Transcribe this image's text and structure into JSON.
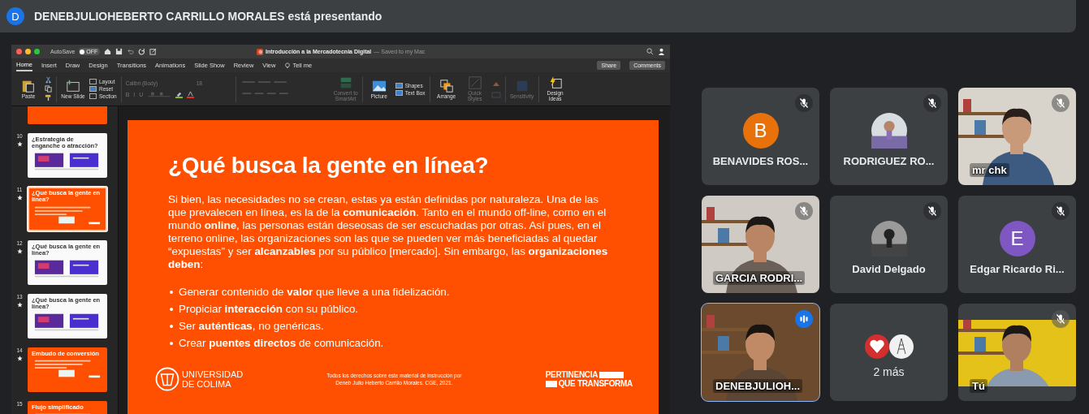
{
  "presenter_banner": {
    "avatar_letter": "D",
    "text": "DENEBJULIOHEBERTO CARRILLO MORALES está presentando"
  },
  "powerpoint": {
    "autosave_label": "AutoSave",
    "autosave_state": "OFF",
    "autosave_on": false,
    "document_title": "Introducción a la Mercadotecnia Digital",
    "save_status": "— Saved to my Mac",
    "tabs": [
      {
        "label": "Home",
        "selected": true
      },
      {
        "label": "Insert",
        "selected": false
      },
      {
        "label": "Draw",
        "selected": false
      },
      {
        "label": "Design",
        "selected": false
      },
      {
        "label": "Transitions",
        "selected": false
      },
      {
        "label": "Animations",
        "selected": false
      },
      {
        "label": "Slide Show",
        "selected": false
      },
      {
        "label": "Review",
        "selected": false
      },
      {
        "label": "View",
        "selected": false
      }
    ],
    "tell_me": "Tell me",
    "share": "Share",
    "comments": "Comments",
    "ribbon": {
      "paste": "Paste",
      "new_slide": "New Slide",
      "layout": "Layout",
      "reset": "Reset",
      "section": "Section",
      "font": "Calibri (Body)",
      "font_size": "18",
      "format_buttons": [
        "B",
        "I",
        "U"
      ],
      "convert": "Convert to SmartArt",
      "picture": "Picture",
      "shapes": "Shapes",
      "text_box": "Text Box",
      "arrange": "Arrange",
      "quick_styles": "Quick Styles",
      "sensitivity": "Sensitivity",
      "design_ideas": "Design Ideas"
    },
    "thumbnails": [
      {
        "kind": "orange",
        "selected": false
      },
      {
        "number": "10",
        "title": "¿Estrategia de enganche o atracción?",
        "kind": "light",
        "animated": true,
        "selected": false
      },
      {
        "number": "11",
        "title": "¿Qué busca la gente en línea?",
        "kind": "orange",
        "animated": true,
        "selected": true
      },
      {
        "number": "12",
        "title": "¿Qué busca la gente en línea?",
        "kind": "light",
        "animated": true,
        "selected": false
      },
      {
        "number": "13",
        "title": "¿Qué busca la gente en línea?",
        "kind": "light",
        "animated": true,
        "selected": false
      },
      {
        "number": "14",
        "title": "Embudo de conversión",
        "kind": "orange",
        "animated": true,
        "selected": false
      },
      {
        "number": "15",
        "title": "Flujo simplificado",
        "kind": "orange",
        "animated": false,
        "selected": false
      }
    ],
    "slide": {
      "title": "¿Qué busca la gente en línea?",
      "paragraph": "Si bien, las necesidades no se crean, estas ya están definidas por naturaleza. Una de las que prevalecen en línea, es la de la **comunicación**. Tanto en el mundo off-line, como en el mundo **online**, las personas están deseosas de ser escuchadas por otras. Así pues, en el terreno online, las organizaciones son las que se pueden ver más beneficiadas al quedar “expuestas” y ser **alcanzables** por su público [mercado]. Sin embargo, las **organizaciones deben**:",
      "bullets": [
        "Generar contenido de **valor** que lleve a una fidelización.",
        "Propiciar **interacción** con su público.",
        "Ser **auténticas**, no genéricas.",
        "Crear **puentes directos** de comunicación."
      ],
      "university": [
        "UNIVERSIDAD",
        "DE COLIMA"
      ],
      "copyright": [
        "Todos los derechos sobre este material de instrucción por",
        "Deneb Julio Heberto Carrillo Morales. CGE, 2021."
      ],
      "slogan": [
        "PERTINENCIA",
        "QUE TRANSFORMA"
      ]
    }
  },
  "participants": [
    {
      "name": "BENAVIDES ROS...",
      "kind": "letter",
      "letter": "B",
      "color": "#e8710a",
      "muted": true,
      "speaking": false
    },
    {
      "name": "RODRIGUEZ RO...",
      "muted": true,
      "speaking": false
    },
    {
      "name": "mr chk",
      "kind": "video",
      "muted": true,
      "speaking": false
    },
    {
      "name": "GARCIA RODRI...",
      "kind": "video",
      "muted": true,
      "speaking": false
    },
    {
      "name": "David Delgado",
      "muted": true,
      "speaking": false
    },
    {
      "name": "Edgar Ricardo Ri...",
      "kind": "letter",
      "letter": "E",
      "color": "#7e57c2",
      "muted": true,
      "speaking": false
    },
    {
      "name": "DENEBJULIOH...",
      "kind": "video",
      "muted": false,
      "speaking": true
    },
    {
      "name": "2 más",
      "kind": "more",
      "muted": false,
      "speaking": false
    },
    {
      "name": "Tú",
      "kind": "video",
      "muted": true,
      "speaking": false
    }
  ]
}
